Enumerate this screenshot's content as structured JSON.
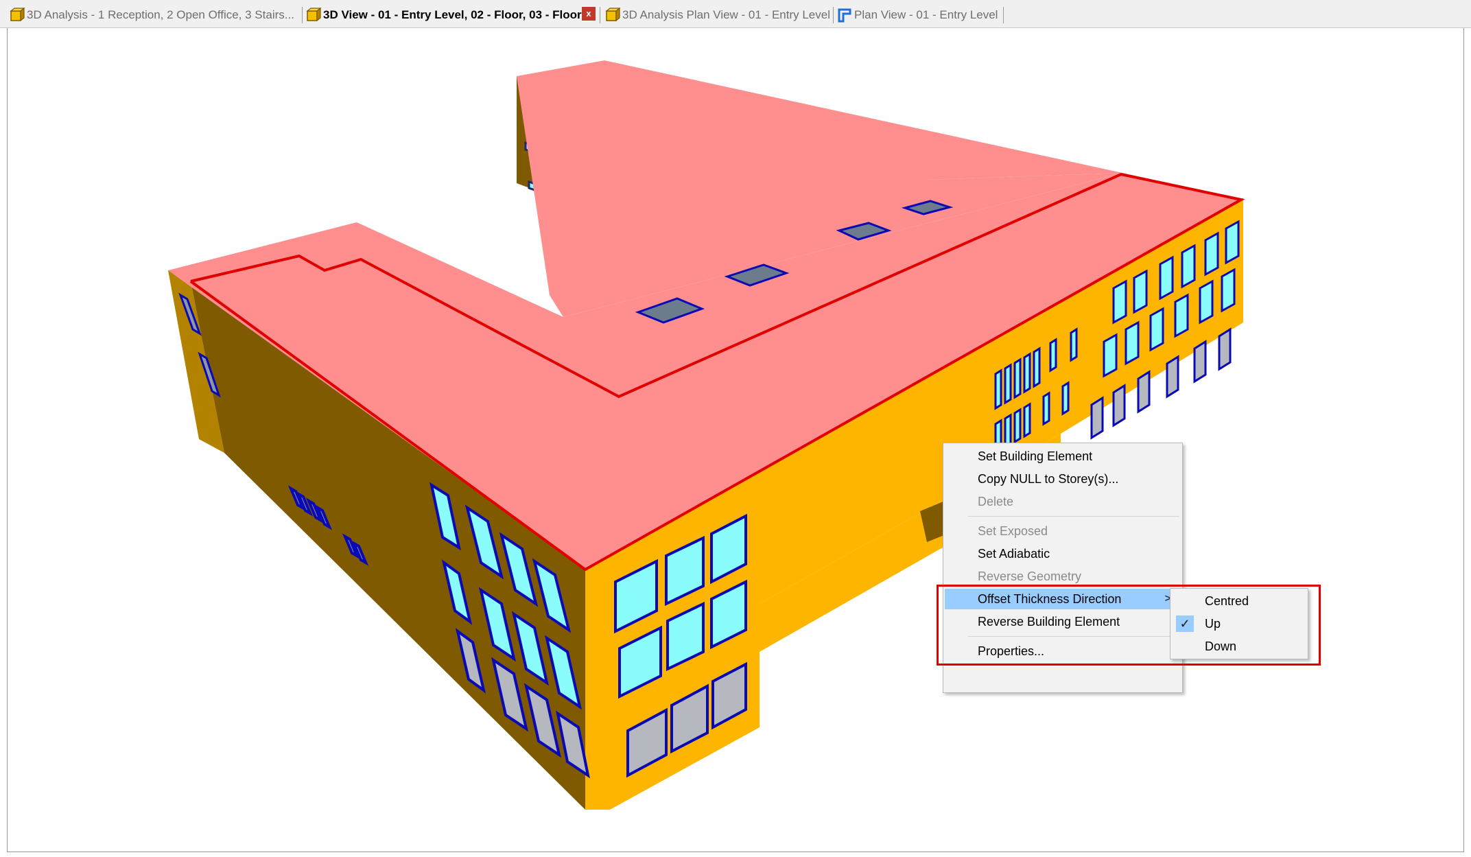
{
  "tabs": [
    {
      "label": "3D Analysis - 1 Reception, 2 Open Office, 3 Stairs...",
      "icon": "3d-model-icon",
      "active": false
    },
    {
      "label": "3D View - 01 - Entry Level, 02 - Floor, 03 - Floor",
      "icon": "3d-model-icon",
      "active": true
    },
    {
      "label": "3D Analysis Plan View - 01 - Entry Level",
      "icon": "3d-model-icon",
      "active": false
    },
    {
      "label": "Plan View - 01 - Entry Level",
      "icon": "plan-view-icon",
      "active": false
    }
  ],
  "close_tab_label": "x",
  "context_menu": {
    "items": [
      {
        "label": "Set Building Element",
        "enabled": true
      },
      {
        "label": "Copy NULL to Storey(s)...",
        "enabled": true
      },
      {
        "label": "Delete",
        "enabled": false
      },
      {
        "label": "Set Exposed",
        "enabled": false
      },
      {
        "label": "Set Adiabatic",
        "enabled": true
      },
      {
        "label": "Reverse Geometry",
        "enabled": false
      },
      {
        "label": "Offset Thickness Direction",
        "enabled": true,
        "highlighted": true,
        "has_submenu": true
      },
      {
        "label": "Reverse Building Element",
        "enabled": true
      },
      {
        "label": "Properties...",
        "enabled": true
      }
    ],
    "submenu_arrow": ">"
  },
  "submenu": {
    "items": [
      {
        "label": "Centred",
        "checked": false
      },
      {
        "label": "Up",
        "checked": true
      },
      {
        "label": "Down",
        "checked": false
      }
    ],
    "check_glyph": "✓"
  },
  "colors": {
    "roof": "#ff8f8f",
    "wall_light": "#fdb500",
    "wall_dark": "#7f5a00",
    "window_glass": "#8afcfc",
    "window_frame": "#0a0ab4",
    "selection": "#e00000",
    "menu_highlight": "#99ccff"
  }
}
